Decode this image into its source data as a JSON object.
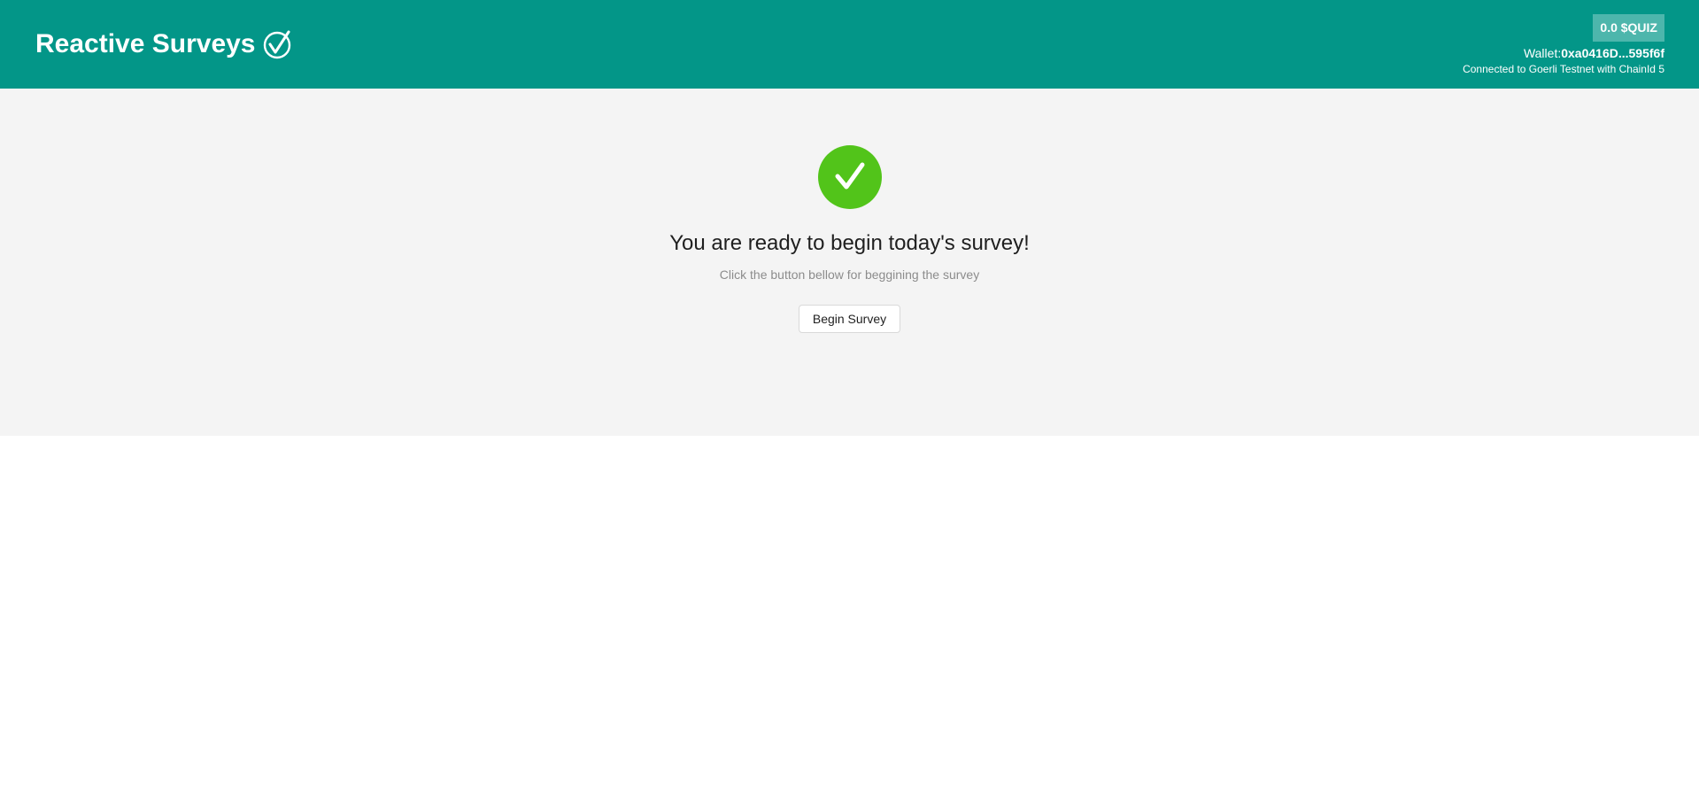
{
  "header": {
    "brand_title": "Reactive Surveys",
    "brand_icon": "checkmark-circle-icon",
    "token_balance": "0.0 $QUIZ",
    "wallet_label": "Wallet:",
    "wallet_address": "0xa0416D...595f6f",
    "network_status": "Connected to Goerli Testnet with ChainId 5"
  },
  "main": {
    "status_icon": "check-circle-icon",
    "title": "You are ready to begin today's survey!",
    "subtitle": "Click the button bellow for beggining the survey",
    "begin_button_label": "Begin Survey"
  },
  "colors": {
    "header_bg": "#039688",
    "badge_bg": "#4db6ac",
    "success": "#52c41a",
    "content_bg": "#f4f4f4"
  }
}
